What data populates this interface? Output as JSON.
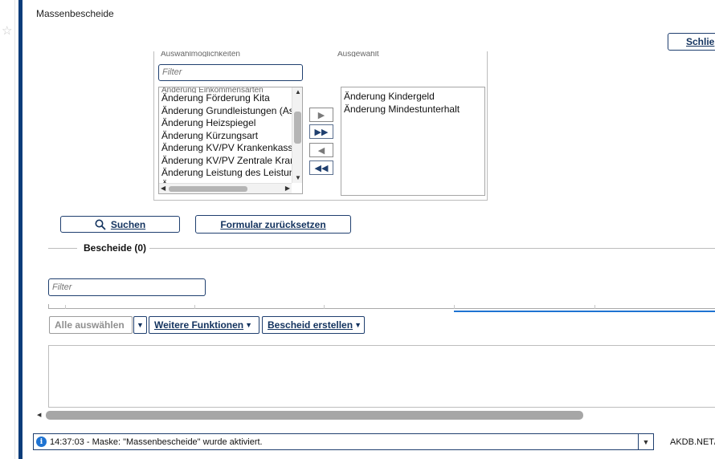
{
  "window": {
    "title": "Massenbescheide"
  },
  "header": {
    "close_label": "Schlie"
  },
  "selector": {
    "available_caption": "Auswahlmöglichkeiten",
    "selected_caption": "Ausgewählt",
    "filter_placeholder": "Filter",
    "top_cut_item": "Änderung Einkommensarten",
    "available_items": [
      "Änderung Förderung Kita",
      "Änderung Grundleistungen (Asy",
      "Änderung Heizspiegel",
      "Änderung Kürzungsart",
      "Änderung KV/PV Krankenkasse",
      "Änderung KV/PV Zentrale Krank",
      "Änderung Leistung des Leistung",
      "Ä"
    ],
    "selected_items": [
      "Änderung Kindergeld",
      "Änderung Mindestunterhalt"
    ],
    "move_buttons": [
      "▶",
      "▶▶",
      "◀",
      "◀◀"
    ]
  },
  "actions": {
    "search_label": "Suchen",
    "reset_label": "Formular zurücksetzen"
  },
  "results": {
    "legend": "Bescheide (0)",
    "filter_placeholder": "Filter",
    "select_all_label": "Alle auswählen",
    "more_functions_label": "Weitere Funktionen",
    "create_label": "Bescheid erstellen"
  },
  "status": {
    "message": "14:37:03 - Maske: \"Massenbescheide\" wurde aktiviert.",
    "right_text": "AKDB.NET/"
  },
  "colors": {
    "accent": "#0b3c7a",
    "button_border": "#1f3f6f",
    "info": "#1e73d2"
  },
  "icons": {
    "search": "magnifier-icon",
    "info": "info-icon",
    "star": "star-icon"
  }
}
